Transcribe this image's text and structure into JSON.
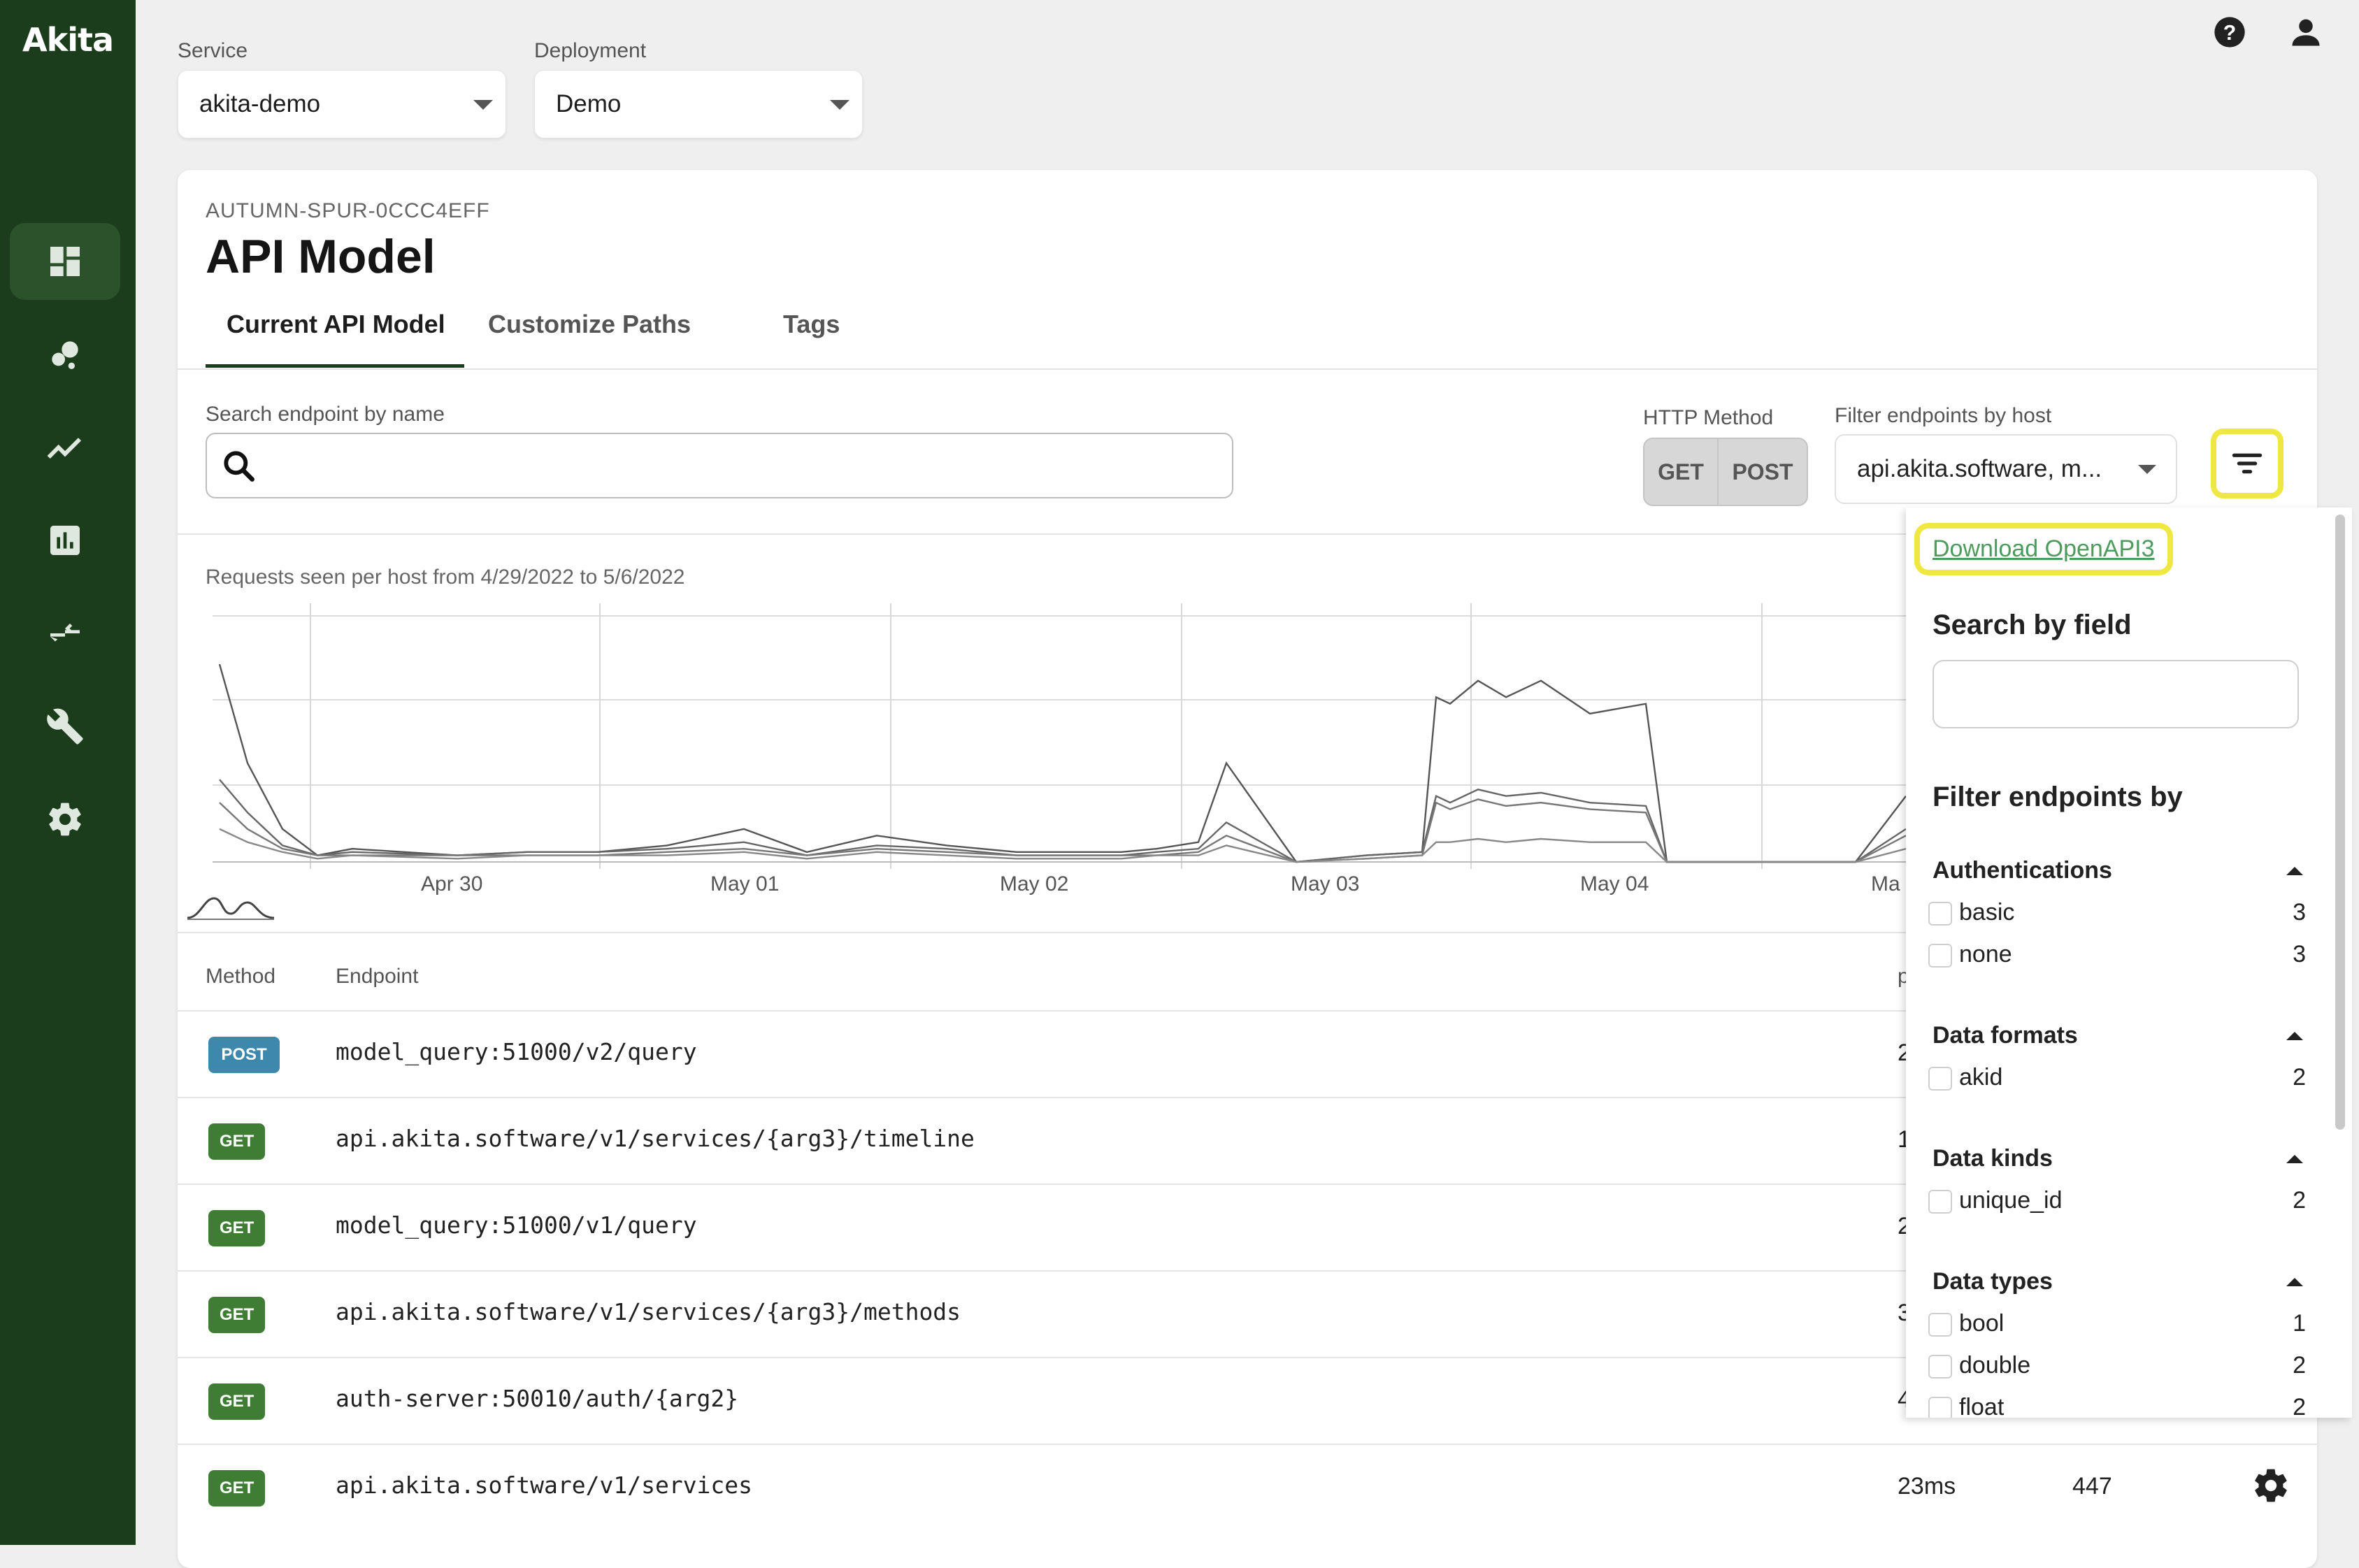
{
  "app": {
    "logo": "Akita"
  },
  "sidebar": {
    "items": [
      {
        "name": "dashboard",
        "icon": "dashboard-icon",
        "active": true
      },
      {
        "name": "dots",
        "icon": "bubble-icon"
      },
      {
        "name": "trend",
        "icon": "trend-icon"
      },
      {
        "name": "chart",
        "icon": "bar-chart-icon"
      },
      {
        "name": "compare",
        "icon": "compare-icon"
      },
      {
        "name": "tools",
        "icon": "wrench-icon"
      },
      {
        "name": "settings",
        "icon": "gear-icon"
      }
    ]
  },
  "topbar": {
    "help_icon": "help-icon",
    "account_icon": "account-icon"
  },
  "service": {
    "label": "Service",
    "value": "akita-demo"
  },
  "deployment": {
    "label": "Deployment",
    "value": "Demo"
  },
  "card": {
    "subtitle": "AUTUMN-SPUR-0CCC4EFF",
    "title": "API Model",
    "tabs": [
      "Current API Model",
      "Customize Paths",
      "Tags"
    ]
  },
  "filters": {
    "search_label": "Search endpoint by name",
    "search_value": "",
    "http_label": "HTTP Method",
    "http_options": [
      "GET",
      "POST"
    ],
    "host_label": "Filter endpoints by host",
    "host_value": "api.akita.software, m..."
  },
  "chart_data": {
    "type": "line",
    "title": "Requests seen per host from 4/29/2022 to 5/6/2022",
    "x_ticks": [
      "Apr 30",
      "May 01",
      "May 02",
      "May 03",
      "May 04",
      "Ma"
    ],
    "grid": true,
    "series": [
      {
        "values": [
          60,
          30,
          10,
          2,
          4,
          2,
          3,
          3,
          5,
          10,
          3,
          8,
          5,
          3,
          3,
          3,
          4,
          6,
          30,
          0,
          2,
          3,
          50,
          48,
          55,
          50,
          55,
          45,
          48,
          0,
          0,
          0,
          0,
          20
        ]
      },
      {
        "values": [
          25,
          15,
          5,
          2,
          3,
          2,
          3,
          3,
          4,
          6,
          2,
          5,
          4,
          2,
          2,
          2,
          3,
          4,
          12,
          0,
          2,
          3,
          20,
          18,
          22,
          20,
          21,
          18,
          17,
          0,
          0,
          0,
          0,
          10
        ]
      },
      {
        "values": [
          18,
          10,
          4,
          2,
          2,
          2,
          2,
          2,
          3,
          4,
          2,
          4,
          3,
          2,
          2,
          2,
          2,
          3,
          8,
          0,
          1,
          2,
          18,
          16,
          19,
          17,
          18,
          16,
          15,
          0,
          0,
          0,
          0,
          8
        ]
      },
      {
        "values": [
          10,
          6,
          3,
          1,
          2,
          1,
          2,
          2,
          2,
          3,
          1,
          3,
          2,
          1,
          1,
          1,
          2,
          2,
          5,
          0,
          1,
          2,
          6,
          6,
          7,
          6,
          7,
          6,
          6,
          0,
          0,
          0,
          0,
          4
        ]
      }
    ]
  },
  "table": {
    "headers": {
      "method": "Method",
      "endpoint": "Endpoint",
      "partial": "p"
    },
    "rows": [
      {
        "method": "POST",
        "endpoint": "model_query:51000/v2/query",
        "latency": "2",
        "count": ""
      },
      {
        "method": "GET",
        "endpoint": "api.akita.software/v1/services/{arg3}/timeline",
        "latency": "1",
        "count": ""
      },
      {
        "method": "GET",
        "endpoint": "model_query:51000/v1/query",
        "latency": "2",
        "count": ""
      },
      {
        "method": "GET",
        "endpoint": "api.akita.software/v1/services/{arg3}/methods",
        "latency": "3",
        "count": ""
      },
      {
        "method": "GET",
        "endpoint": "auth-server:50010/auth/{arg2}",
        "latency": "4",
        "count": ""
      },
      {
        "method": "GET",
        "endpoint": "api.akita.software/v1/services",
        "latency": "23ms",
        "count": "447"
      }
    ]
  },
  "panel": {
    "download_link": "Download OpenAPI3",
    "search_heading": "Search by field",
    "search_value": "",
    "filter_heading": "Filter endpoints by",
    "groups": [
      {
        "title": "Authentications",
        "options": [
          {
            "label": "basic",
            "count": "3"
          },
          {
            "label": "none",
            "count": "3"
          }
        ]
      },
      {
        "title": "Data formats",
        "options": [
          {
            "label": "akid",
            "count": "2"
          }
        ]
      },
      {
        "title": "Data kinds",
        "options": [
          {
            "label": "unique_id",
            "count": "2"
          }
        ]
      },
      {
        "title": "Data types",
        "options": [
          {
            "label": "bool",
            "count": "1"
          },
          {
            "label": "double",
            "count": "2"
          },
          {
            "label": "float",
            "count": "2"
          }
        ]
      }
    ]
  }
}
